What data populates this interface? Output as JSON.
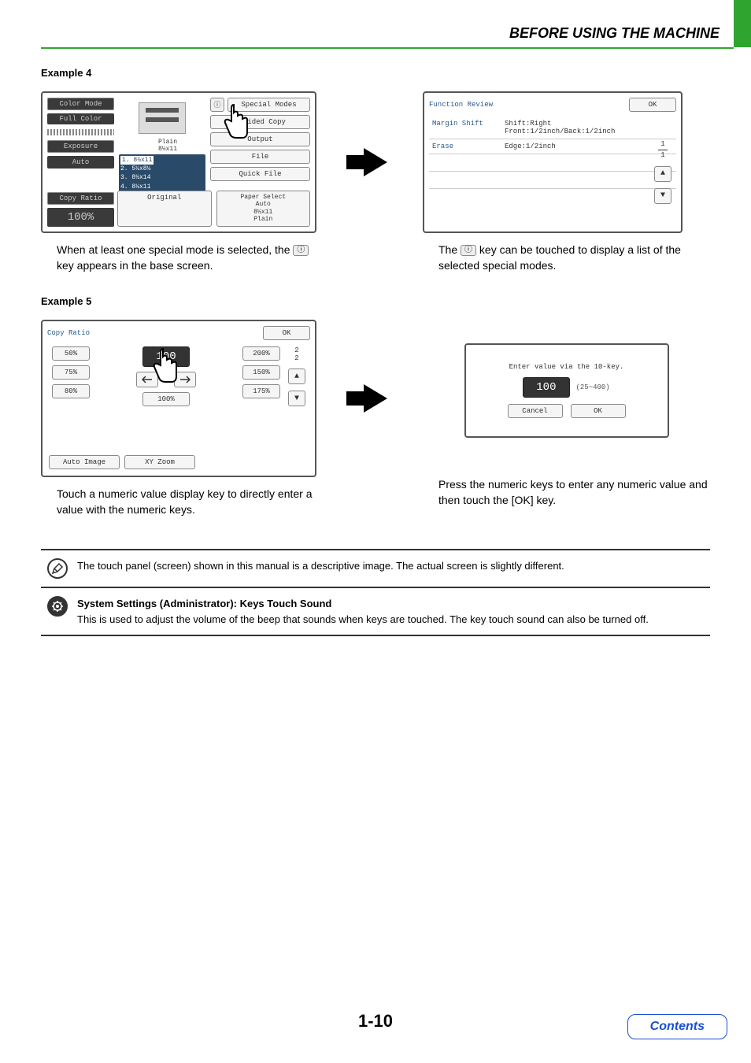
{
  "header": {
    "title": "BEFORE USING THE MACHINE"
  },
  "example4": {
    "heading": "Example 4",
    "panel_copy": {
      "color_mode": "Color Mode",
      "full_color": "Full Color",
      "exposure": "Exposure",
      "auto": "Auto",
      "copy_ratio": "Copy Ratio",
      "ratio_value": "100%",
      "original": "Original",
      "paper_select": "Paper Select",
      "paper_auto": "Auto",
      "paper_size": "8½x11",
      "paper_type": "Plain",
      "plain_label": "Plain",
      "plain_size": "8½x11",
      "trays": {
        "t1": "1. 8½x11",
        "t2": "2. 5½x8½",
        "t3": "3. 8½x14",
        "t4": "4. 8½x11"
      },
      "buttons": {
        "special_modes": "Special Modes",
        "two_sided": "2-Sided Copy",
        "output": "Output",
        "file": "File",
        "quick_file": "Quick File"
      }
    },
    "panel_review": {
      "title": "Function Review",
      "ok": "OK",
      "rows": {
        "margin_shift": {
          "label": "Margin Shift",
          "val1": "Shift:Right",
          "val2": "Front:1/2inch/Back:1/2inch"
        },
        "erase": {
          "label": "Erase",
          "val": "Edge:1/2inch"
        }
      },
      "page_current": "1",
      "page_total": "1"
    },
    "caption_left_a": "When at least one special mode is selected, the ",
    "caption_left_b": " key appears in the base screen.",
    "caption_right_a": "The ",
    "caption_right_b": " key can be touched to display a list of the selected special modes."
  },
  "example5": {
    "heading": "Example 5",
    "panel_ratio": {
      "title": "Copy Ratio",
      "ok": "OK",
      "left_pcts": [
        "50%",
        "75%",
        "80%"
      ],
      "right_pcts": [
        "200%",
        "150%",
        "175%"
      ],
      "display": "100",
      "hundred_btn": "100%",
      "auto_image": "Auto Image",
      "xy_zoom": "XY Zoom",
      "page_current": "2",
      "page_total": "2"
    },
    "panel_entry": {
      "hint": "Enter value via the 10-key.",
      "display": "100",
      "range": "(25~400)",
      "cancel": "Cancel",
      "ok": "OK"
    },
    "caption_left": "Touch a numeric value display key to directly enter a value with the numeric keys.",
    "caption_right": "Press the numeric keys to enter any numeric value and then touch the [OK] key."
  },
  "notes": {
    "note1": "The touch panel (screen) shown in this manual is a descriptive image. The actual screen is slightly different.",
    "note2_title": "System Settings (Administrator): Keys Touch Sound",
    "note2_body": "This is used to adjust the volume of the beep that sounds when keys are touched. The key touch sound can also be turned off."
  },
  "footer": {
    "page": "1-10",
    "contents": "Contents"
  }
}
